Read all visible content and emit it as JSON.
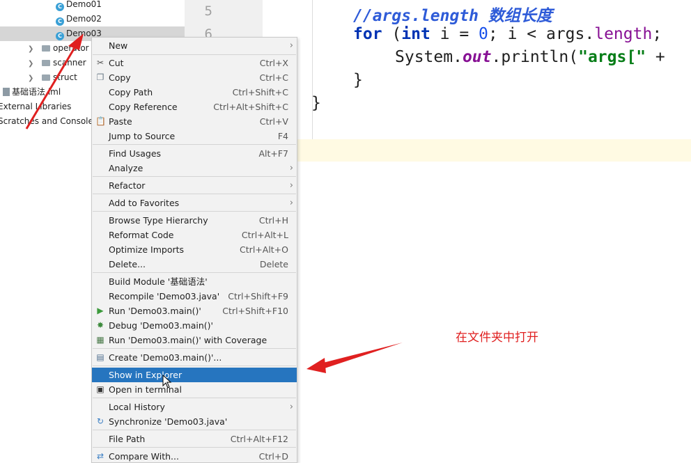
{
  "tree": {
    "items": [
      {
        "label": "Demo01",
        "kind": "class",
        "icon": "class-icon"
      },
      {
        "label": "Demo02",
        "kind": "class",
        "icon": "class-icon"
      },
      {
        "label": "Demo03",
        "kind": "class",
        "icon": "class-icon",
        "selected": true
      },
      {
        "label": "operator",
        "kind": "folder",
        "icon": "folder-icon"
      },
      {
        "label": "scanner",
        "kind": "folder",
        "icon": "folder-icon"
      },
      {
        "label": "struct",
        "kind": "folder",
        "icon": "folder-icon"
      },
      {
        "label": "基础语法.iml",
        "kind": "file",
        "icon": "module-file-icon"
      },
      {
        "label": "External Libraries",
        "kind": "root",
        "icon": "library-icon"
      },
      {
        "label": "Scratches and Consoles",
        "kind": "root",
        "icon": "scratches-icon"
      }
    ]
  },
  "gutter": {
    "line_numbers": [
      "5",
      "6"
    ]
  },
  "editor": {
    "line1_comment": "//args.length 数组长度",
    "line2": {
      "kw_for": "for",
      "open": " (",
      "kw_int": "int",
      "mid": " i = ",
      "zero": "0",
      "mid2": "; i < args.",
      "length": "length",
      "end": ";"
    },
    "line3": {
      "pre": "System.",
      "out": "out",
      "mid": ".println(",
      "str": "\"args[\"",
      "end": " +"
    },
    "line4": "}",
    "line5": "}"
  },
  "menu": {
    "items": [
      {
        "label": "New",
        "shortcut": "",
        "submenu": true,
        "icon": ""
      },
      {
        "label": "Cut",
        "shortcut": "Ctrl+X",
        "icon": "cut-icon"
      },
      {
        "label": "Copy",
        "shortcut": "Ctrl+C",
        "icon": "copy-icon"
      },
      {
        "label": "Copy Path",
        "shortcut": "Ctrl+Shift+C",
        "icon": ""
      },
      {
        "label": "Copy Reference",
        "shortcut": "Ctrl+Alt+Shift+C",
        "icon": ""
      },
      {
        "label": "Paste",
        "shortcut": "Ctrl+V",
        "icon": "paste-icon"
      },
      {
        "label": "Jump to Source",
        "shortcut": "F4",
        "icon": ""
      },
      {
        "label": "Find Usages",
        "shortcut": "Alt+F7",
        "icon": ""
      },
      {
        "label": "Analyze",
        "shortcut": "",
        "submenu": true,
        "icon": ""
      },
      {
        "label": "Refactor",
        "shortcut": "",
        "submenu": true,
        "icon": ""
      },
      {
        "label": "Add to Favorites",
        "shortcut": "",
        "submenu": true,
        "icon": ""
      },
      {
        "label": "Browse Type Hierarchy",
        "shortcut": "Ctrl+H",
        "icon": ""
      },
      {
        "label": "Reformat Code",
        "shortcut": "Ctrl+Alt+L",
        "icon": ""
      },
      {
        "label": "Optimize Imports",
        "shortcut": "Ctrl+Alt+O",
        "icon": ""
      },
      {
        "label": "Delete...",
        "shortcut": "Delete",
        "icon": ""
      },
      {
        "label": "Build Module '基础语法'",
        "shortcut": "",
        "icon": ""
      },
      {
        "label": "Recompile 'Demo03.java'",
        "shortcut": "Ctrl+Shift+F9",
        "icon": ""
      },
      {
        "label": "Run 'Demo03.main()'",
        "shortcut": "Ctrl+Shift+F10",
        "icon": "run-icon"
      },
      {
        "label": "Debug 'Demo03.main()'",
        "shortcut": "",
        "icon": "debug-icon"
      },
      {
        "label": "Run 'Demo03.main()' with Coverage",
        "shortcut": "",
        "icon": "coverage-icon"
      },
      {
        "label": "Create 'Demo03.main()'...",
        "shortcut": "",
        "icon": "create-config-icon"
      },
      {
        "label": "Show in Explorer",
        "shortcut": "",
        "icon": "",
        "highlighted": true
      },
      {
        "label": "Open in terminal",
        "shortcut": "",
        "icon": "terminal-icon"
      },
      {
        "label": "Local History",
        "shortcut": "",
        "submenu": true,
        "icon": ""
      },
      {
        "label": "Synchronize 'Demo03.java'",
        "shortcut": "",
        "icon": "sync-icon"
      },
      {
        "label": "File Path",
        "shortcut": "Ctrl+Alt+F12",
        "icon": ""
      },
      {
        "label": "Compare With...",
        "shortcut": "Ctrl+D",
        "icon": "compare-icon"
      }
    ]
  },
  "annotation": {
    "label": "在文件夹中打开",
    "color": "#e02020"
  },
  "colors": {
    "highlight": "#2675bf",
    "menu_bg": "#f2f2f2",
    "keyword": "#0033b3"
  }
}
